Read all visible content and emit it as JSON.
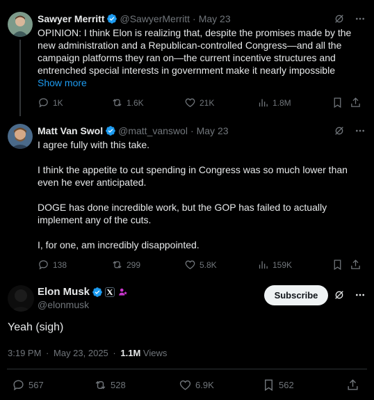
{
  "tweet1": {
    "name": "Sawyer Merritt",
    "handle": "@SawyerMerritt",
    "date": "May 23",
    "sep": "·",
    "lines": [
      "OPINION: I think Elon is realizing that, despite the promises made by the",
      "new administration and a Republican-controlled Congress—and all the",
      "campaign platforms they ran on—the current incentive structures and",
      "entrenched special interests in government make it nearly impossible"
    ],
    "show_more": "Show more",
    "replies": "1K",
    "reposts": "1.6K",
    "likes": "21K",
    "views": "1.8M"
  },
  "tweet2": {
    "name": "Matt Van Swol",
    "handle": "@matt_vanswol",
    "date": "May 23",
    "sep": "·",
    "para1": "I agree fully with this take.",
    "para2_l1": "I think the appetite to cut spending in Congress was so much lower than",
    "para2_l2": "even he ever anticipated.",
    "para3_l1": "DOGE has done incredible work, but the GOP has failed to actually",
    "para3_l2": "implement any of the cuts.",
    "para4": "I, for one, am incredibly disappointed.",
    "replies": "138",
    "reposts": "299",
    "likes": "5.8K",
    "views": "159K"
  },
  "main_tweet": {
    "name": "Elon Musk",
    "handle": "@elonmusk",
    "subscribe": "Subscribe",
    "text": "Yeah (sigh)",
    "time": "3:19 PM",
    "date": "May 23, 2025",
    "sep": "·",
    "views_count": "1.1M",
    "views_label": "Views",
    "replies": "567",
    "reposts": "528",
    "likes": "6.9K",
    "bookmarks": "562"
  },
  "colors": {
    "background": "#000000",
    "text": "#e7e9ea",
    "muted": "#71767b",
    "link": "#1d9bf0",
    "verified": "#1d9bf0",
    "divider": "#2f3336"
  }
}
